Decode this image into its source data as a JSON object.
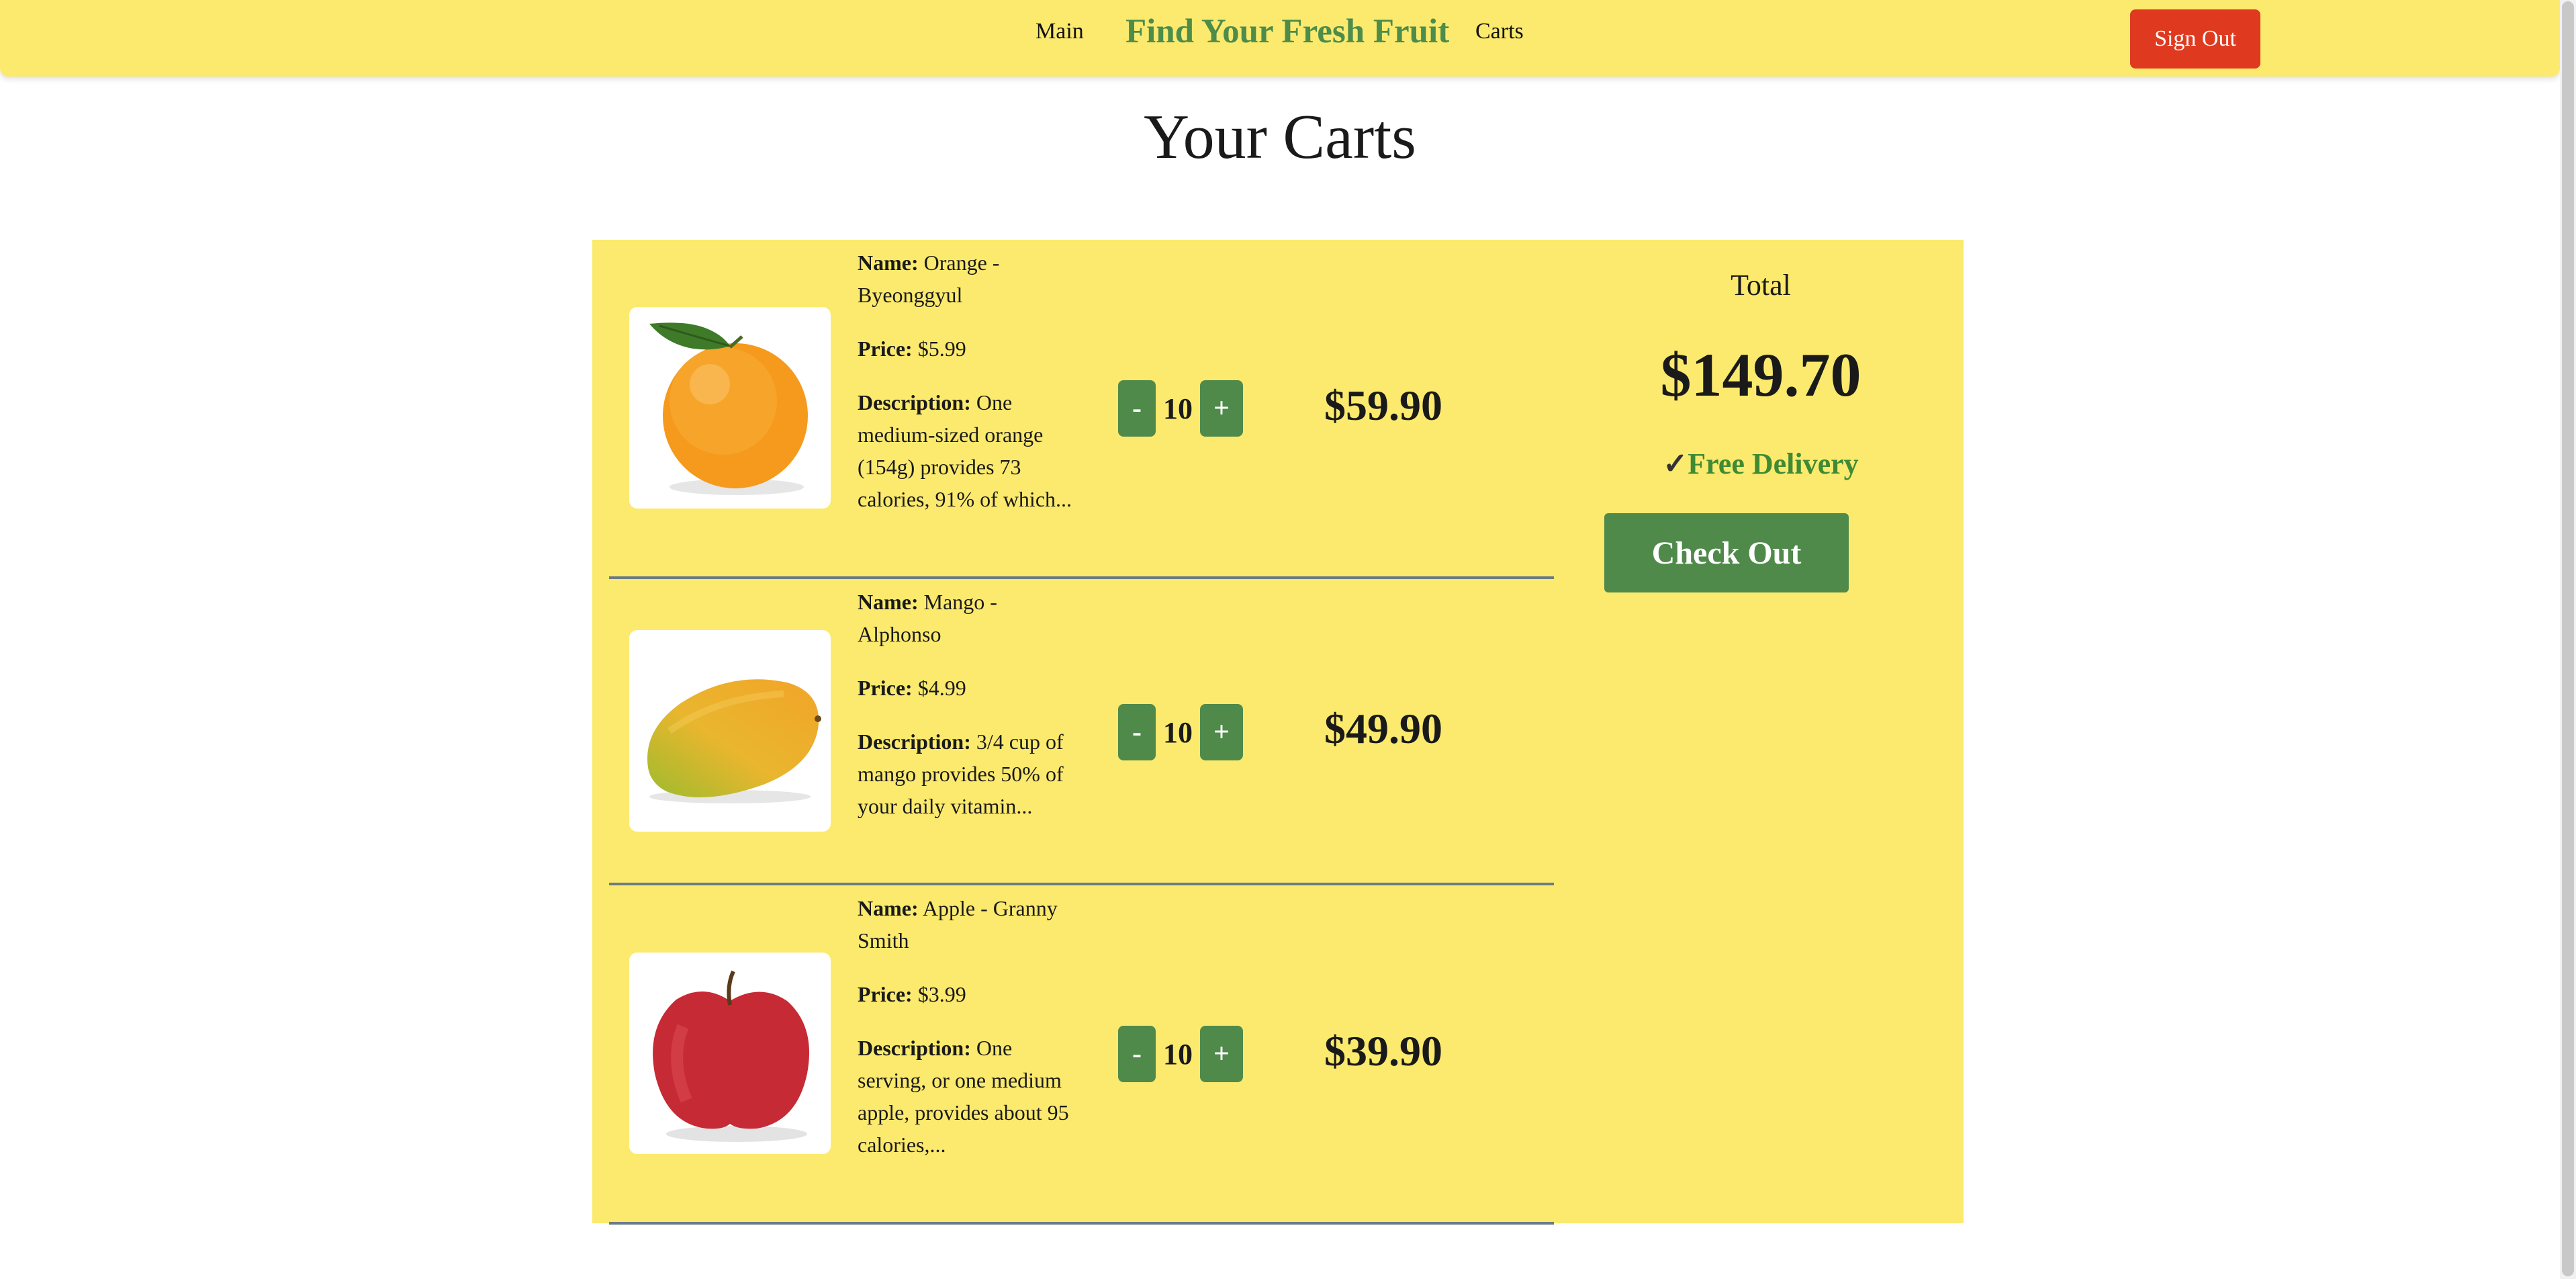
{
  "nav": {
    "main_label": "Main",
    "brand": "Find Your Fresh Fruit",
    "carts_label": "Carts",
    "signout_label": "Sign Out"
  },
  "page": {
    "title": "Your Carts"
  },
  "labels": {
    "name": "Name:",
    "price": "Price:",
    "description": "Description:"
  },
  "cart_items": [
    {
      "name": "Orange - Byeonggyul",
      "price": "$5.99",
      "description": "One medium-sized orange (154g) provides 73 calories, 91% of which...",
      "quantity": "10",
      "minus_label": "-",
      "plus_label": "+",
      "line_total": "$59.90",
      "image": "orange-image"
    },
    {
      "name": "Mango - Alphonso",
      "price": "$4.99",
      "description": "3/4 cup of mango provides 50% of your daily vitamin...",
      "quantity": "10",
      "minus_label": "-",
      "plus_label": "+",
      "line_total": "$49.90",
      "image": "mango-image"
    },
    {
      "name": "Apple - Granny Smith",
      "price": "$3.99",
      "description": "One serving, or one medium apple, provides about 95 calories,...",
      "quantity": "10",
      "minus_label": "-",
      "plus_label": "+",
      "line_total": "$39.90",
      "image": "apple-image"
    }
  ],
  "summary": {
    "total_label": "Total",
    "total_value": "$149.70",
    "check_icon": "✓",
    "delivery_label": "Free Delivery",
    "checkout_label": "Check Out"
  },
  "colors": {
    "header_bg": "#fbea6e",
    "brand_green": "#4d8c4a",
    "button_green": "#4f8a4a",
    "signout_red": "#df3a20",
    "delivery_green": "#3f8a33"
  }
}
